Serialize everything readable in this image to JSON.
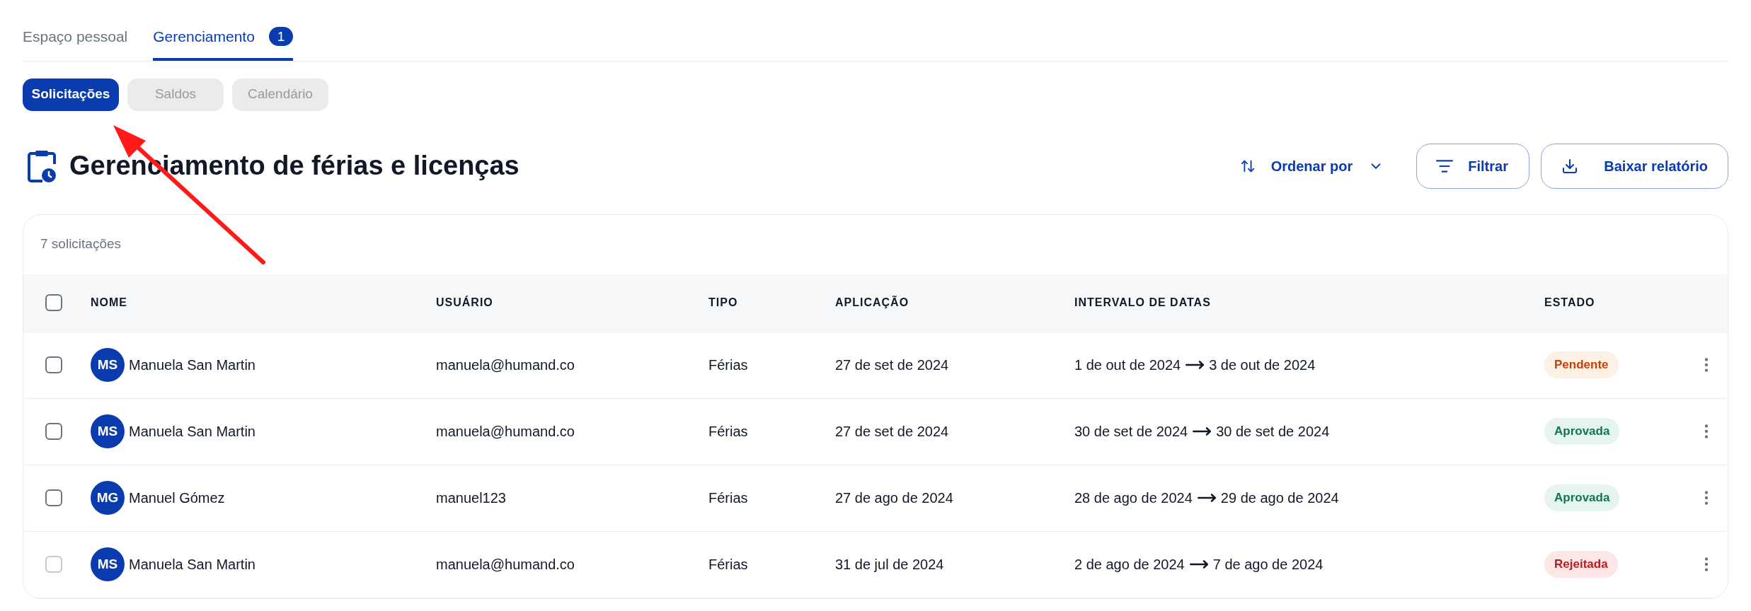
{
  "tabs": [
    {
      "label": "Espaço pessoal",
      "selected": false
    },
    {
      "label": "Gerenciamento",
      "selected": true,
      "badge": "1"
    }
  ],
  "subtabs": [
    {
      "label": "Solicitações",
      "selected": true
    },
    {
      "label": "Saldos",
      "selected": false
    },
    {
      "label": "Calendário",
      "selected": false
    }
  ],
  "page_title": "Gerenciamento de férias e licenças",
  "toolbar": {
    "sort": "Ordenar por",
    "filter": "Filtrar",
    "download": "Baixar relatório"
  },
  "table": {
    "count": "7 solicitações",
    "select_all_checked": false,
    "columns": [
      "NOME",
      "USUÁRIO",
      "TIPO",
      "APLICAÇÃO",
      "INTERVALO DE DATAS",
      "ESTADO"
    ],
    "rows": [
      {
        "checked": false,
        "disabled": false,
        "initials": "MS",
        "name": "Manuela San Martin",
        "user": "manuela@humand.co",
        "type": "Férias",
        "applied": "27 de set de 2024",
        "from": "1 de out de 2024",
        "to": "3 de out de 2024",
        "status": "Pendente",
        "kind": "pending"
      },
      {
        "checked": false,
        "disabled": false,
        "initials": "MS",
        "name": "Manuela San Martin",
        "user": "manuela@humand.co",
        "type": "Férias",
        "applied": "27 de set de 2024",
        "from": "30 de set de 2024",
        "to": "30 de set de 2024",
        "status": "Aprovada",
        "kind": "approved"
      },
      {
        "checked": false,
        "disabled": false,
        "initials": "MG",
        "name": "Manuel Gómez",
        "user": "manuel123",
        "type": "Férias",
        "applied": "27 de ago de 2024",
        "from": "28 de ago de 2024",
        "to": "29 de ago de 2024",
        "status": "Aprovada",
        "kind": "approved"
      },
      {
        "checked": false,
        "disabled": true,
        "initials": "MS",
        "name": "Manuela San Martin",
        "user": "manuela@humand.co",
        "type": "Férias",
        "applied": "31 de jul de 2024",
        "from": "2 de ago de 2024",
        "to": "7 de ago de 2024",
        "status": "Rejeitada",
        "kind": "rejected"
      }
    ]
  }
}
